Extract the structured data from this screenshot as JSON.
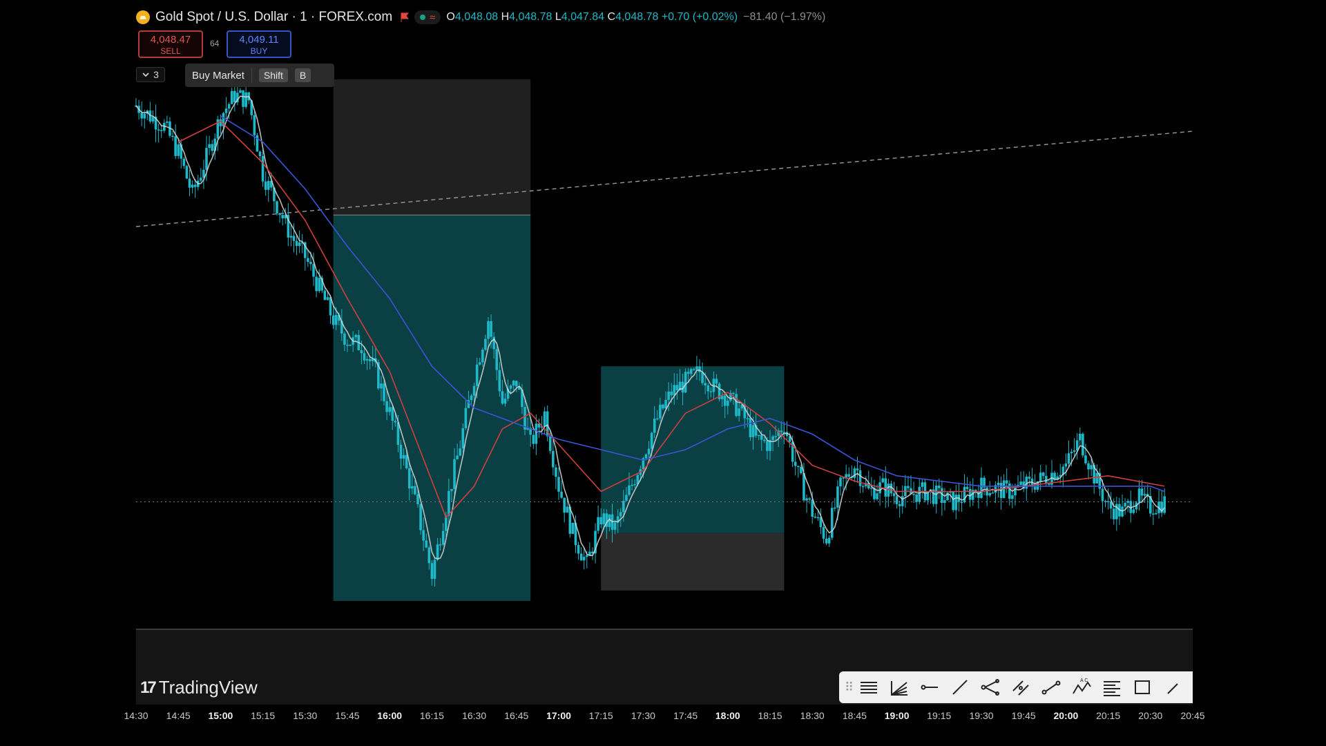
{
  "header": {
    "symbol": "Gold Spot / U.S. Dollar · 1 · FOREX.com",
    "open_label": "O",
    "open": "4,048.08",
    "high_label": "H",
    "high": "4,048.78",
    "low_label": "L",
    "low": "4,047.84",
    "close_label": "C",
    "close": "4,048.78",
    "change": "+0.70 (+0.02%)",
    "day_change": "−81.40 (−1.97%)"
  },
  "trade": {
    "sell_price": "4,048.47",
    "sell_label": "SELL",
    "buy_price": "4,049.11",
    "buy_label": "BUY",
    "spread": "64"
  },
  "order": {
    "quantity": "3",
    "tooltip": "Buy Market",
    "key1": "Shift",
    "key2": "B"
  },
  "branding": {
    "name": "TradingView"
  },
  "colors": {
    "candle": "#1fb8c8",
    "ma_fast": "#d9d9d9",
    "ma_mid": "#d04040",
    "ma_slow": "#3a56d8",
    "zone_profit": "#0e5a60",
    "zone_stop": "#3a3a3a"
  },
  "toolbar": {
    "icons": [
      "horizontal-lines-icon",
      "fib-fan-icon",
      "horizontal-ray-icon",
      "trend-line-icon",
      "pitchfork-icon",
      "parallel-channel-icon",
      "path-icon",
      "abcd-pattern-icon",
      "fib-retracement-icon",
      "rectangle-icon",
      "more-tools-icon"
    ]
  },
  "chart_data": {
    "type": "candlestick",
    "x_ticks": [
      "14:30",
      "14:45",
      "15:00",
      "15:15",
      "15:30",
      "15:45",
      "16:00",
      "16:15",
      "16:30",
      "16:45",
      "17:00",
      "17:15",
      "17:30",
      "17:45",
      "18:00",
      "18:15",
      "18:30",
      "18:45",
      "19:00",
      "19:15",
      "19:30",
      "19:45",
      "20:00",
      "20:15",
      "20:30",
      "20:45"
    ],
    "bold_ticks": [
      "15:00",
      "16:00",
      "17:00",
      "18:00",
      "19:00",
      "20:00"
    ],
    "close_path": [
      [
        "14:30",
        0.95
      ],
      [
        "14:40",
        0.91
      ],
      [
        "14:45",
        0.86
      ],
      [
        "14:50",
        0.78
      ],
      [
        "14:55",
        0.85
      ],
      [
        "15:00",
        0.93
      ],
      [
        "15:05",
        0.97
      ],
      [
        "15:10",
        0.96
      ],
      [
        "15:15",
        0.82
      ],
      [
        "15:20",
        0.76
      ],
      [
        "15:25",
        0.7
      ],
      [
        "15:30",
        0.66
      ],
      [
        "15:35",
        0.6
      ],
      [
        "15:40",
        0.54
      ],
      [
        "15:45",
        0.5
      ],
      [
        "15:50",
        0.49
      ],
      [
        "15:55",
        0.44
      ],
      [
        "16:00",
        0.36
      ],
      [
        "16:05",
        0.27
      ],
      [
        "16:10",
        0.17
      ],
      [
        "16:15",
        0.05
      ],
      [
        "16:20",
        0.18
      ],
      [
        "16:25",
        0.3
      ],
      [
        "16:30",
        0.43
      ],
      [
        "16:35",
        0.54
      ],
      [
        "16:40",
        0.38
      ],
      [
        "16:45",
        0.42
      ],
      [
        "16:50",
        0.3
      ],
      [
        "16:55",
        0.36
      ],
      [
        "17:00",
        0.22
      ],
      [
        "17:05",
        0.13
      ],
      [
        "17:10",
        0.07
      ],
      [
        "17:15",
        0.16
      ],
      [
        "17:20",
        0.14
      ],
      [
        "17:25",
        0.21
      ],
      [
        "17:30",
        0.28
      ],
      [
        "17:35",
        0.35
      ],
      [
        "17:40",
        0.4
      ],
      [
        "17:45",
        0.42
      ],
      [
        "17:50",
        0.44
      ],
      [
        "17:55",
        0.41
      ],
      [
        "18:00",
        0.39
      ],
      [
        "18:05",
        0.36
      ],
      [
        "18:10",
        0.31
      ],
      [
        "18:15",
        0.3
      ],
      [
        "18:20",
        0.34
      ],
      [
        "18:25",
        0.24
      ],
      [
        "18:30",
        0.17
      ],
      [
        "18:35",
        0.12
      ],
      [
        "18:40",
        0.22
      ],
      [
        "18:45",
        0.26
      ],
      [
        "18:50",
        0.21
      ],
      [
        "18:55",
        0.22
      ],
      [
        "19:00",
        0.2
      ],
      [
        "19:10",
        0.21
      ],
      [
        "19:20",
        0.19
      ],
      [
        "19:30",
        0.22
      ],
      [
        "19:40",
        0.21
      ],
      [
        "19:50",
        0.23
      ],
      [
        "20:00",
        0.26
      ],
      [
        "20:05",
        0.31
      ],
      [
        "20:10",
        0.24
      ],
      [
        "20:15",
        0.18
      ],
      [
        "20:20",
        0.17
      ],
      [
        "20:25",
        0.2
      ],
      [
        "20:30",
        0.18
      ],
      [
        "20:35",
        0.19
      ]
    ],
    "ma_red": [
      [
        "14:45",
        0.88
      ],
      [
        "15:00",
        0.92
      ],
      [
        "15:15",
        0.84
      ],
      [
        "15:30",
        0.73
      ],
      [
        "15:45",
        0.58
      ],
      [
        "16:00",
        0.44
      ],
      [
        "16:10",
        0.3
      ],
      [
        "16:20",
        0.16
      ],
      [
        "16:30",
        0.22
      ],
      [
        "16:40",
        0.33
      ],
      [
        "16:50",
        0.36
      ],
      [
        "17:00",
        0.3
      ],
      [
        "17:15",
        0.21
      ],
      [
        "17:30",
        0.25
      ],
      [
        "17:45",
        0.36
      ],
      [
        "18:00",
        0.4
      ],
      [
        "18:15",
        0.34
      ],
      [
        "18:30",
        0.26
      ],
      [
        "18:45",
        0.23
      ],
      [
        "19:00",
        0.21
      ],
      [
        "19:30",
        0.21
      ],
      [
        "20:00",
        0.23
      ],
      [
        "20:15",
        0.24
      ],
      [
        "20:35",
        0.22
      ]
    ],
    "ma_blue": [
      [
        "15:00",
        0.93
      ],
      [
        "15:15",
        0.88
      ],
      [
        "15:30",
        0.79
      ],
      [
        "15:45",
        0.68
      ],
      [
        "16:00",
        0.58
      ],
      [
        "16:15",
        0.45
      ],
      [
        "16:30",
        0.37
      ],
      [
        "16:45",
        0.34
      ],
      [
        "17:00",
        0.31
      ],
      [
        "17:15",
        0.29
      ],
      [
        "17:30",
        0.27
      ],
      [
        "17:45",
        0.29
      ],
      [
        "18:00",
        0.33
      ],
      [
        "18:15",
        0.35
      ],
      [
        "18:30",
        0.32
      ],
      [
        "18:45",
        0.27
      ],
      [
        "19:00",
        0.24
      ],
      [
        "19:30",
        0.22
      ],
      [
        "20:00",
        0.22
      ],
      [
        "20:30",
        0.22
      ],
      [
        "20:35",
        0.21
      ]
    ],
    "position_short": {
      "start": "15:40",
      "end": "16:50",
      "entry": 0.74,
      "stop_top": 1.0,
      "target": 0.0
    },
    "position_long": {
      "start": "17:15",
      "end": "18:20",
      "entry": 0.13,
      "stop_bottom": 0.02,
      "target": 0.45
    },
    "current_price_level": 0.19,
    "y_range": [
      0,
      1
    ]
  }
}
